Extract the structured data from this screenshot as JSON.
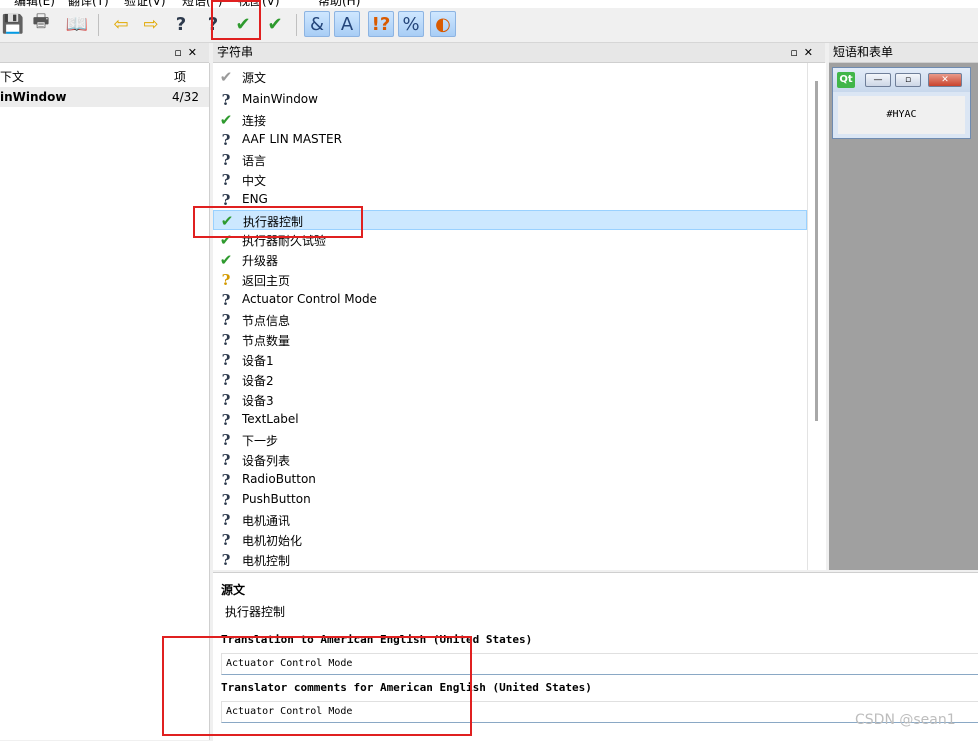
{
  "menu": [
    "编辑(E)",
    "翻译(T)",
    "验证(V)",
    "短语(P)",
    "视图(V)",
    "帮助(H)"
  ],
  "toolbar": {
    "buttons": [
      "save-icon",
      "print-icon",
      "phrase-book-icon",
      "prev-icon",
      "next-icon",
      "prev-unfinished-icon",
      "next-unfinished-icon",
      "done-next-icon",
      "done-icon",
      "accelerators-icon",
      "ending-punctuation-icon",
      "phrase-matches-icon",
      "place-marker-icon",
      "surrounding-whitespace-icon"
    ]
  },
  "context_panel": {
    "header_col1": "下文",
    "header_col2": "项",
    "rows": [
      {
        "name": "inWindow",
        "count": "4/32"
      }
    ]
  },
  "strings_panel": {
    "title": "字符串",
    "header": "源文",
    "rows": [
      {
        "status": "q",
        "text": "MainWindow"
      },
      {
        "status": "ok",
        "text": "连接"
      },
      {
        "status": "q",
        "text": "AAF LIN MASTER"
      },
      {
        "status": "q",
        "text": "语言"
      },
      {
        "status": "q",
        "text": "中文"
      },
      {
        "status": "q",
        "text": "ENG"
      },
      {
        "status": "ok",
        "text": "执行器控制",
        "selected": true
      },
      {
        "status": "ok",
        "text": "执行器耐久试验"
      },
      {
        "status": "ok",
        "text": "升级器"
      },
      {
        "status": "qy",
        "text": "返回主页"
      },
      {
        "status": "q",
        "text": "Actuator Control Mode"
      },
      {
        "status": "q",
        "text": "节点信息"
      },
      {
        "status": "q",
        "text": "节点数量"
      },
      {
        "status": "q",
        "text": "设备1"
      },
      {
        "status": "q",
        "text": "设备2"
      },
      {
        "status": "q",
        "text": "设备3"
      },
      {
        "status": "q",
        "text": "TextLabel"
      },
      {
        "status": "q",
        "text": "下一步"
      },
      {
        "status": "q",
        "text": "设备列表"
      },
      {
        "status": "q",
        "text": "RadioButton"
      },
      {
        "status": "q",
        "text": "PushButton"
      },
      {
        "status": "q",
        "text": "电机通讯"
      },
      {
        "status": "q",
        "text": "电机初始化"
      },
      {
        "status": "q",
        "text": "电机控制"
      }
    ]
  },
  "phrases_panel": {
    "title": "短语和表单",
    "preview_logo": "Qt",
    "preview_text": "#HYAC"
  },
  "editor": {
    "source_label": "源文",
    "source_text": "执行器控制",
    "translation_label": "Translation to American English (United States)",
    "translation_value": "Actuator Control Mode",
    "comments_label": "Translator comments for American English (United States)",
    "comments_value": "Actuator Control Mode"
  },
  "watermark": "CSDN @sean1"
}
